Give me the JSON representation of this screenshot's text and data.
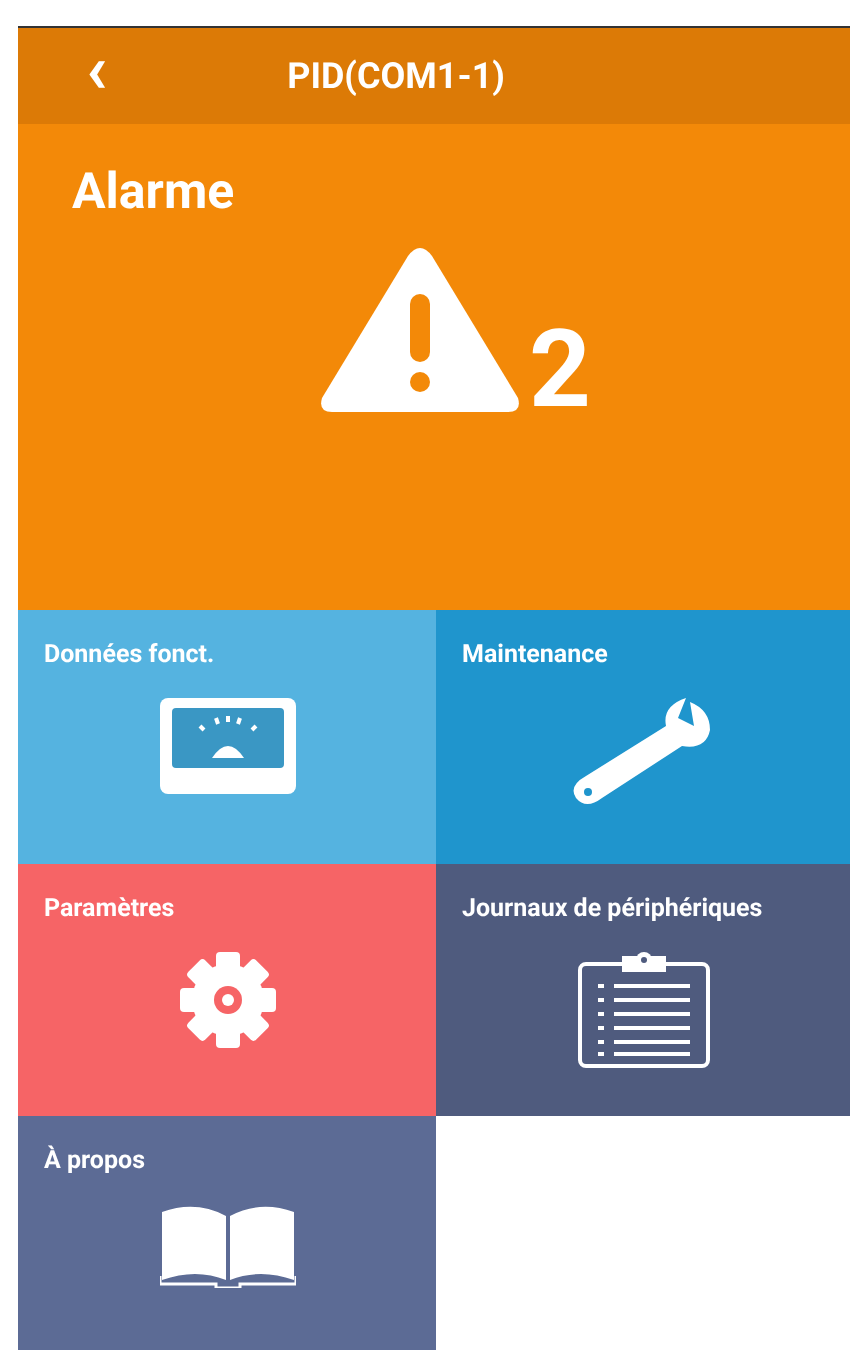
{
  "header": {
    "back": "‹",
    "title": "PID(COM1-1)"
  },
  "alarm": {
    "label": "Alarme",
    "count": "2"
  },
  "tiles": [
    {
      "label": "Données fonct.",
      "kind": "gauge",
      "color": "#55b3e0"
    },
    {
      "label": "Maintenance",
      "kind": "wrench",
      "color": "#1f95cd"
    },
    {
      "label": "Paramètres",
      "kind": "gear",
      "color": "#f66466"
    },
    {
      "label": "Journaux de périphériques",
      "kind": "clipboard",
      "color": "#4f5b7e"
    },
    {
      "label": "À propos",
      "kind": "book",
      "color": "#5c6b95"
    }
  ]
}
